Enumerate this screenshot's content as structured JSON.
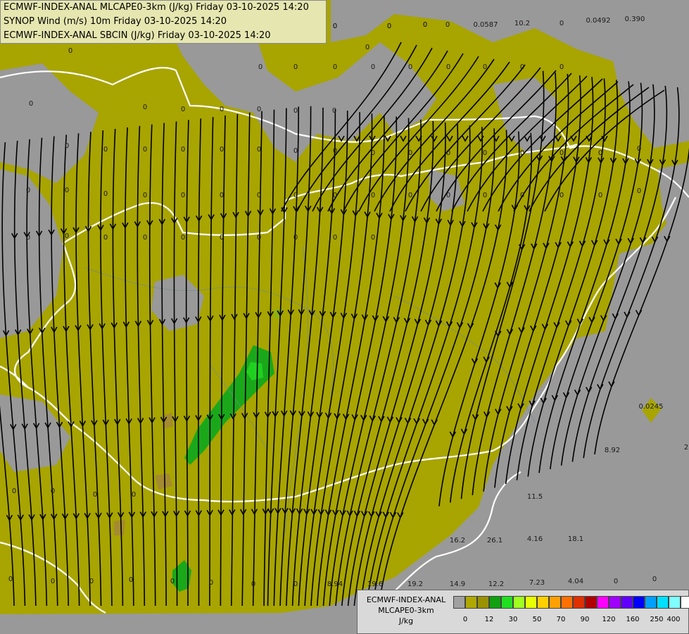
{
  "header": {
    "line1": "ECMWF-INDEX-ANAL MLCAPE0-3km (J/kg) Friday 03-10-2025 14:20",
    "line2": "SYNOP Wind (m/s) 10m Friday 03-10-2025 14:20",
    "line3": "ECMWF-INDEX-ANAL SBCIN (J/kg) Friday 03-10-2025 14:20"
  },
  "legend": {
    "title_line1": "ECMWF-INDEX-ANAL",
    "title_line2": "MLCAPE0-3km",
    "title_line3": "J/kg",
    "colors": [
      "#a0a0a0",
      "#b0a800",
      "#9a9200",
      "#10a010",
      "#20e020",
      "#a0ff20",
      "#e8ff00",
      "#ffd000",
      "#ffa000",
      "#ff7000",
      "#e03000",
      "#b00000",
      "#ff00ff",
      "#a000ff",
      "#6000ff",
      "#0000ff",
      "#00a0ff",
      "#00e0ff",
      "#80ffff",
      "#ffffff"
    ],
    "ticks": [
      "0",
      "12",
      "30",
      "50",
      "70",
      "90",
      "120",
      "160",
      "250",
      "400"
    ]
  },
  "map": {
    "colors": {
      "background_gray": "#999999",
      "cape_fill": "#a8a400",
      "cape_green": "#1aa81a",
      "border_white": "#ffffff",
      "streamline": "#000000"
    },
    "value_labels": [
      "0",
      "0",
      "0",
      "0",
      "0",
      "0",
      "0",
      "0",
      "0",
      "0",
      "0",
      "0",
      "0.0587",
      "10.2",
      "0",
      "0.0492",
      "0.390",
      "0",
      "0",
      "0",
      "0",
      "0",
      "0",
      "0",
      "0",
      "0",
      "0",
      "0",
      "0",
      "0",
      "0",
      "0",
      "0",
      "0",
      "0",
      "0",
      "0",
      "0",
      "0",
      "0",
      "0",
      "0",
      "0",
      "0",
      "0",
      "0",
      "0",
      "0",
      "0",
      "0",
      "0",
      "0",
      "0",
      "0",
      "0",
      "0",
      "0",
      "0",
      "0",
      "0",
      "0",
      "0",
      "0",
      "0",
      "0",
      "0",
      "0",
      "0",
      "0",
      "0",
      "0.0245",
      "8.92",
      "2",
      "11.5",
      "16.2",
      "26.1",
      "4.16",
      "18.1",
      "8.94",
      "19.6",
      "19.2",
      "14.9",
      "12.2",
      "7.23",
      "4.04",
      "0",
      "0",
      "0",
      "0",
      "0",
      "0",
      "0",
      "0",
      "0",
      "0",
      "0",
      "0",
      "0",
      "0",
      "0",
      "0",
      "0"
    ]
  }
}
